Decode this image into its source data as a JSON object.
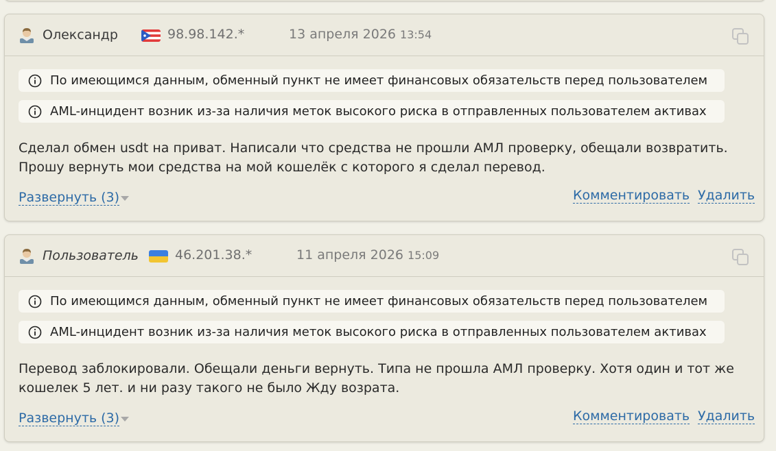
{
  "reviews": [
    {
      "author": "Олександр",
      "ip": "98.98.142.*",
      "date": "13 апреля 2026",
      "time": "13:54",
      "notices": [
        "По имеющимся данным, обменный пункт не имеет финансовых обязательств перед пользователем",
        "AML-инцидент возник из-за наличия меток высокого риска в отправленных пользователем активах"
      ],
      "text": "Сделал обмен usdt на приват. Написали что средства не прошли АМЛ проверку, обещали возвратить. Прошу вернуть мои средства на мой кошелёк с которого я сделал перевод.",
      "expand_label": "Развернуть (3)",
      "comment_label": "Комментировать",
      "delete_label": "Удалить"
    },
    {
      "author": "Пользователь",
      "ip": "46.201.38.*",
      "date": "11 апреля 2026",
      "time": "15:09",
      "notices": [
        "По имеющимся данным, обменный пункт не имеет финансовых обязательств перед пользователем",
        "AML-инцидент возник из-за наличия меток высокого риска в отправленных пользователем активах"
      ],
      "text": "Перевод заблокировали. Обещали деньги вернуть. Типа не прошла АМЛ проверку. Хотя один и тот же кошелек 5 лет. и ни разу такого не было Жду возрата.",
      "expand_label": "Развернуть (3)",
      "comment_label": "Комментировать",
      "delete_label": "Удалить"
    }
  ],
  "icons": {
    "avatar": "user-avatar-icon",
    "flag_1": "puerto-rico-flag-icon",
    "flag_2": "ukraine-flag-icon",
    "copy": "copy-icon",
    "info": "info-icon",
    "expand": "chevron-down-icon"
  },
  "colors": {
    "link": "#2c6aa6",
    "card_bg": "#eceadf",
    "notice_bg": "#f8f7f1",
    "border": "#cfcdc0"
  }
}
